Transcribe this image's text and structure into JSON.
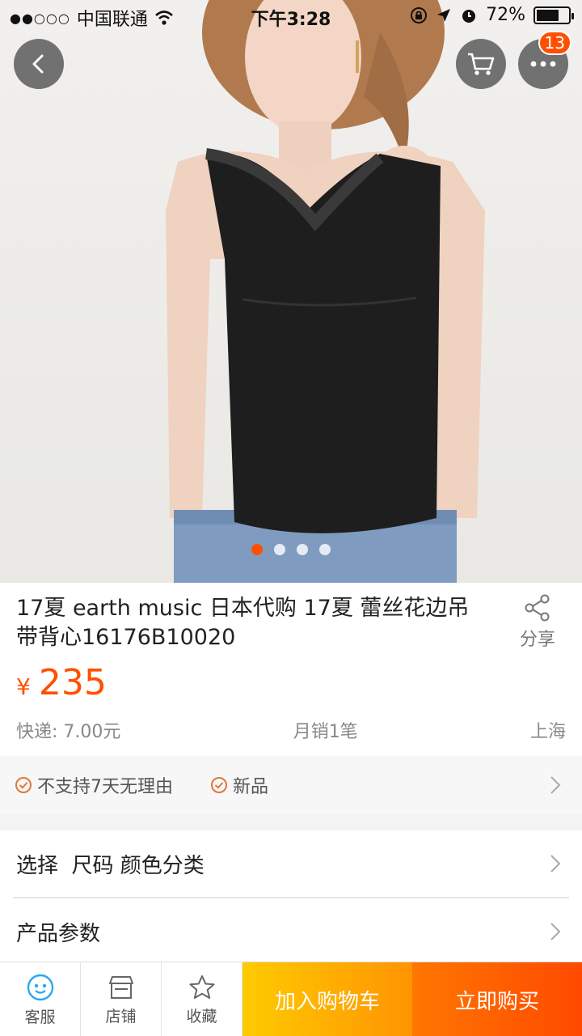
{
  "status_bar": {
    "signal": "●●○○○",
    "carrier": "中国联通",
    "time": "下午3:28",
    "battery": "72%",
    "battery_level": 0.72
  },
  "header": {
    "back_icon": "chevron-left-icon",
    "cart_icon": "cart-icon",
    "more_icon": "ellipsis-icon",
    "more_badge": "13"
  },
  "gallery": {
    "image_count": 4,
    "active_index": 0
  },
  "product": {
    "title": "17夏 earth music 日本代购 17夏 蕾丝花边吊带背心16176B10020",
    "currency": "¥",
    "price": "235",
    "shipping": "快递: 7.00元",
    "monthly_sales": "月销1笔",
    "location": "上海",
    "share_label": "分享"
  },
  "services": {
    "items": [
      "不支持7天无理由",
      "新品"
    ]
  },
  "options": {
    "select_label": "选择  尺码 颜色分类",
    "params_label": "产品参数"
  },
  "bottom_bar": {
    "service_label": "客服",
    "shop_label": "店铺",
    "favorite_label": "收藏",
    "add_to_cart_label": "加入购物车",
    "buy_now_label": "立即购买"
  },
  "colors": {
    "accent": "#ff5000",
    "cart_gradient": [
      "#ffcb00",
      "#ff9402"
    ],
    "buy_gradient": [
      "#ff7700",
      "#ff4900"
    ]
  }
}
